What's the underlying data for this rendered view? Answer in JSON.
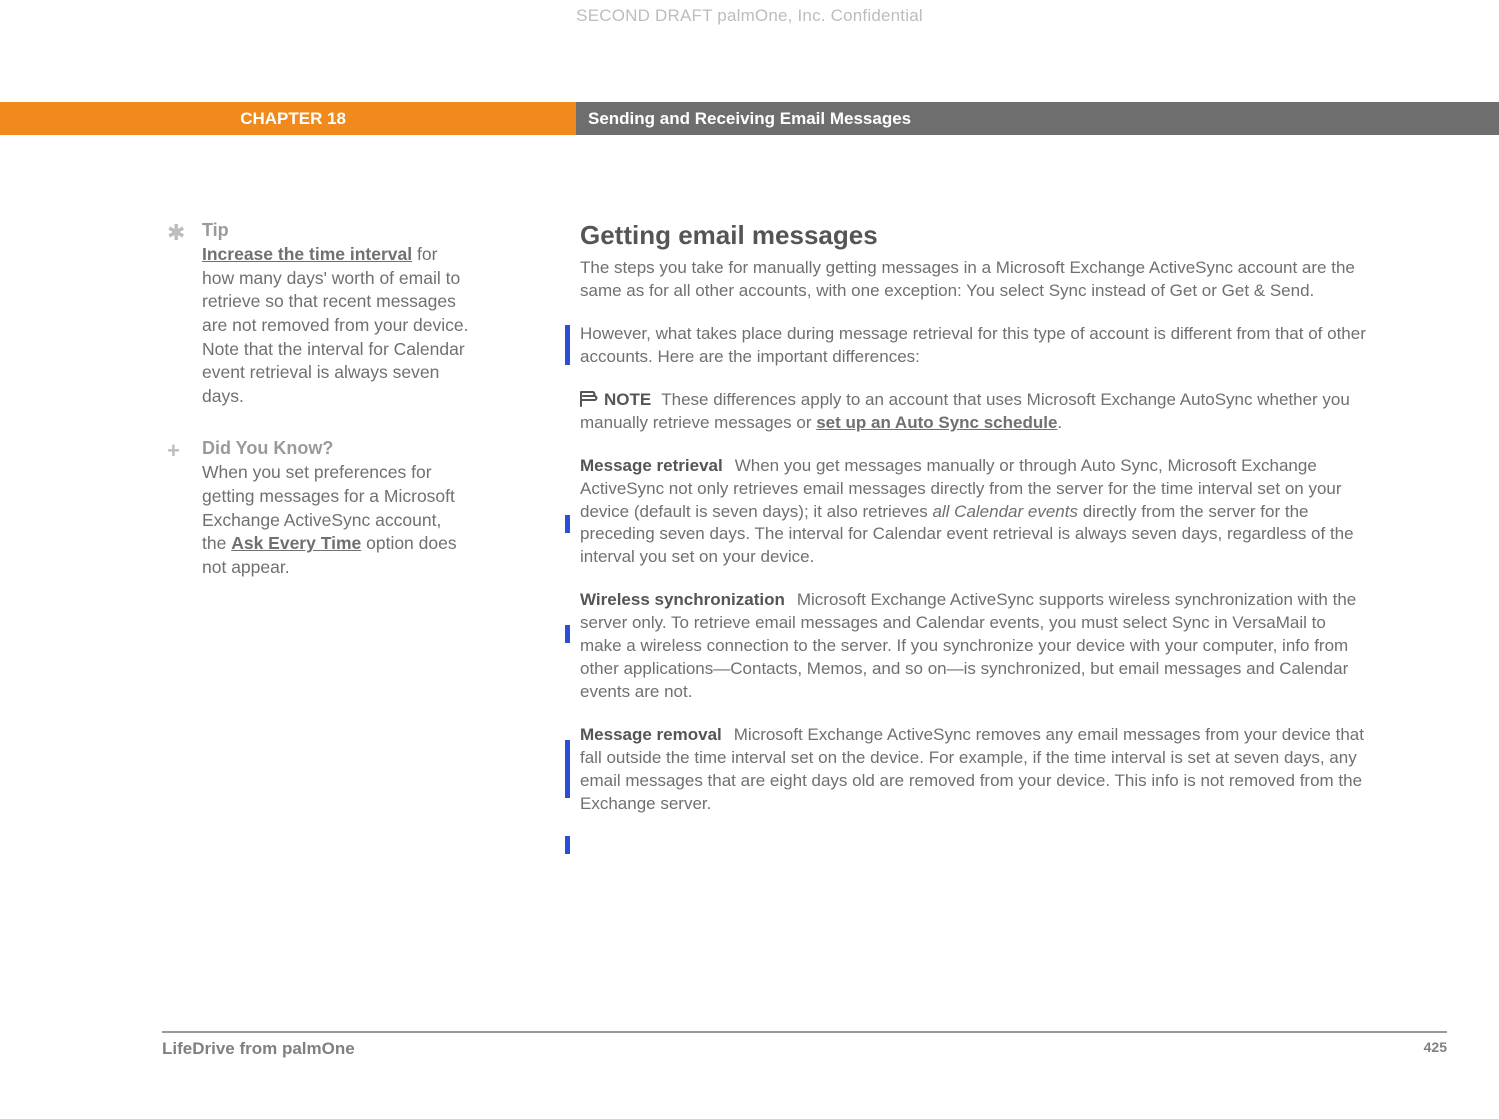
{
  "header": {
    "watermark": "SECOND DRAFT palmOne, Inc.  Confidential",
    "chapter_label": "CHAPTER 18",
    "chapter_title": "Sending and Receiving Email Messages"
  },
  "sidebar": {
    "tip": {
      "title": "Tip",
      "link": "Increase the time interval",
      "body_rest": " for how many days' worth of email to retrieve so that recent messages are not removed from your device. Note that the interval for Calendar event retrieval is always seven days."
    },
    "dyk": {
      "title": "Did You Know?",
      "body_pre": "When you set preferences for getting messages for a Microsoft Exchange ActiveSync account, the ",
      "link": "Ask Every Time",
      "body_post": " option does not appear."
    }
  },
  "main": {
    "heading": "Getting email messages",
    "intro": "The steps you take for manually getting messages in a Microsoft Exchange ActiveSync account are the same as for all other accounts, with one exception: You select Sync instead of Get or Get & Send.",
    "diff_intro": "However, what takes place during message retrieval for this type of account is different from that of other accounts. Here are the important differences:",
    "note": {
      "label": "NOTE",
      "text_pre": "These differences apply to an account that uses Microsoft Exchange AutoSync whether you manually retrieve messages or ",
      "link": "set up an Auto Sync schedule",
      "text_post": "."
    },
    "sections": {
      "retrieval": {
        "label": "Message retrieval",
        "text_pre": "When you get messages manually or through Auto Sync, Microsoft Exchange ActiveSync not only retrieves email messages directly from the server for the time interval set on your device (default is seven days); it also retrieves ",
        "italic": "all Calendar events",
        "text_post": " directly from the server for the preceding seven days. The interval for Calendar event retrieval is always seven days, regardless of the interval you set on your device."
      },
      "wireless": {
        "label": "Wireless synchronization",
        "text": "Microsoft Exchange ActiveSync supports wireless synchronization with the server only. To retrieve email messages and Calendar events, you must select Sync in VersaMail to make a wireless connection to the server. If you synchronize your device with your computer, info from other applications—Contacts, Memos, and so on—is synchronized, but email messages and Calendar events are not."
      },
      "removal": {
        "label": "Message removal",
        "text": "Microsoft Exchange ActiveSync removes any email messages from your device that fall outside the time interval set on the device. For example, if the time interval is set at seven days, any email messages that are eight days old are removed from your device. This info is not removed from the Exchange server."
      }
    }
  },
  "footer": {
    "product": "LifeDrive from palmOne",
    "page_number": "425"
  }
}
